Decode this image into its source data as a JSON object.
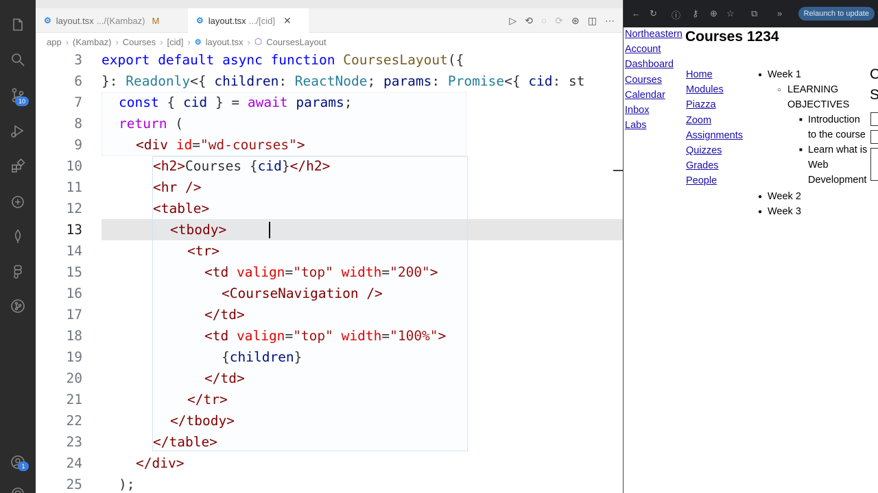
{
  "activity": {
    "scm_badge": "10",
    "accounts_badge": "1"
  },
  "tabs": [
    {
      "name": "layout.tsx",
      "path": ".../(Kambaz)",
      "flag": "M"
    },
    {
      "name": "layout.tsx",
      "path": ".../[cid]"
    }
  ],
  "breadcrumb": [
    "app",
    "(Kambaz)",
    "Courses",
    "[cid]",
    "layout.tsx",
    "CoursesLayout"
  ],
  "code": {
    "lines": [
      {
        "num": "3"
      },
      {
        "num": "6"
      },
      {
        "num": "7"
      },
      {
        "num": "8"
      },
      {
        "num": "9"
      },
      {
        "num": "10"
      },
      {
        "num": "11"
      },
      {
        "num": "12"
      },
      {
        "num": "13"
      },
      {
        "num": "14"
      },
      {
        "num": "15"
      },
      {
        "num": "16"
      },
      {
        "num": "17"
      },
      {
        "num": "18"
      },
      {
        "num": "19"
      },
      {
        "num": "20"
      },
      {
        "num": "21"
      },
      {
        "num": "22"
      },
      {
        "num": "23"
      },
      {
        "num": "24"
      },
      {
        "num": "25"
      }
    ],
    "tokens": {
      "l3": [
        "export",
        " default ",
        "async",
        " function ",
        "CoursesLayout",
        "({"
      ],
      "l6": [
        "}: ",
        "Readonly",
        "<{ ",
        "children",
        ": ",
        "ReactNode",
        "; ",
        "params",
        ": ",
        "Promise",
        "<{ ",
        "cid",
        ": st"
      ],
      "l7": [
        "const",
        " { ",
        "cid",
        " } = ",
        "await",
        " ",
        "params",
        ";"
      ],
      "l8": [
        "return",
        " ("
      ],
      "l9": [
        "<div",
        " ",
        "id",
        "=",
        "\"wd-courses\"",
        ">"
      ],
      "l10": [
        "<h2>",
        "Courses {",
        "cid",
        "}",
        "</h2>"
      ],
      "l11": [
        "<hr />"
      ],
      "l12": [
        "<table>"
      ],
      "l13": [
        "<tbody>"
      ],
      "l14": [
        "<tr>"
      ],
      "l15": [
        "<td",
        " ",
        "valign",
        "=",
        "\"top\"",
        " ",
        "width",
        "=",
        "\"200\"",
        ">"
      ],
      "l16": [
        "<CourseNavigation />"
      ],
      "l17": [
        "</td>"
      ],
      "l18": [
        "<td",
        " ",
        "valign",
        "=",
        "\"top\"",
        " ",
        "width",
        "=",
        "\"100%\"",
        ">"
      ],
      "l19": [
        "{",
        "children",
        "}"
      ],
      "l20": [
        "</td>"
      ],
      "l21": [
        "</tr>"
      ],
      "l22": [
        "</tbody>"
      ],
      "l23": [
        "</table>"
      ],
      "l24": [
        "</div>"
      ],
      "l25": [
        ");"
      ]
    }
  },
  "browser": {
    "relaunch": "Relaunch to update",
    "heading": "Courses 1234",
    "kambaz_nav": [
      "Northeastern",
      "Account",
      "Dashboard",
      "Courses",
      "Calendar",
      "Inbox",
      "Labs"
    ],
    "course_nav": [
      "Home",
      "Modules",
      "Piazza",
      "Zoom",
      "Assignments",
      "Quizzes",
      "Grades",
      "People"
    ],
    "modules": {
      "week1": "Week 1",
      "learning1": "LEARNING",
      "learning2": "OBJECTIVES",
      "intro1": "Introduction",
      "intro2": "to the course",
      "learn1": "Learn what is",
      "learn2": "Web",
      "learn3": "Development",
      "week2": "Week 2",
      "week3": "Week 3"
    },
    "edge_letters": [
      "C",
      "S"
    ]
  }
}
